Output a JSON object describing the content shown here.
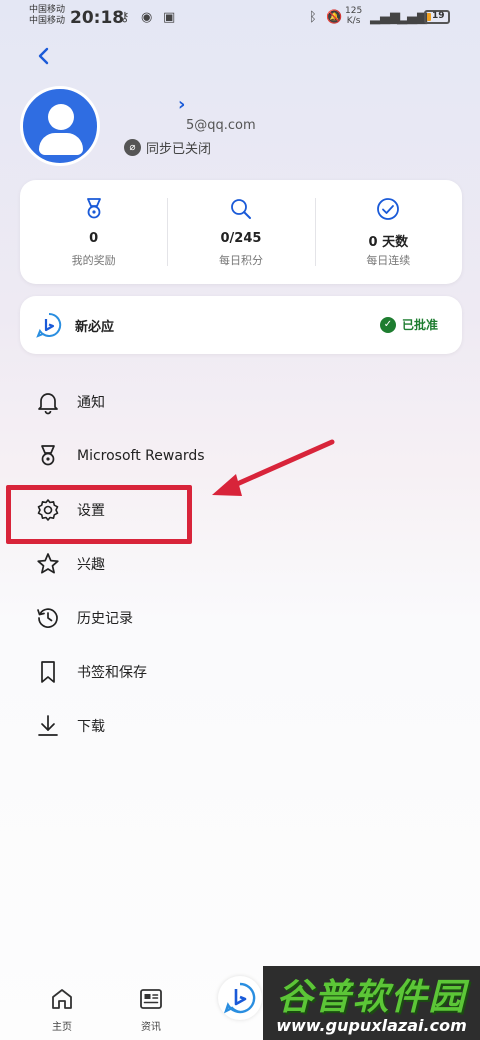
{
  "status_bar": {
    "carrier_1": "中国移动",
    "carrier_2": "中国移动",
    "time": "20:18",
    "network_speed_value": "125",
    "network_speed_unit": "K/s",
    "battery": "19",
    "battery_level": 0.19
  },
  "profile": {
    "arrow": "›",
    "email": "5@qq.com",
    "sync_label": "同步已关闭"
  },
  "stats": [
    {
      "value": "0",
      "label": "我的奖励",
      "icon": "medal-icon"
    },
    {
      "value": "0/245",
      "label": "每日积分",
      "icon": "search-icon"
    },
    {
      "value": "0 天数",
      "label": "每日连续",
      "icon": "check-circle-icon"
    }
  ],
  "bing_card": {
    "title": "新必应",
    "status": "已批准"
  },
  "menu": [
    {
      "label": "通知",
      "icon": "bell-icon"
    },
    {
      "label": "Microsoft Rewards",
      "icon": "medal-icon"
    },
    {
      "label": "设置",
      "icon": "gear-icon"
    },
    {
      "label": "兴趣",
      "icon": "star-icon"
    },
    {
      "label": "历史记录",
      "icon": "history-icon"
    },
    {
      "label": "书签和保存",
      "icon": "bookmark-icon"
    },
    {
      "label": "下载",
      "icon": "download-icon"
    }
  ],
  "bottom_nav": {
    "home": "主页",
    "news": "资讯"
  },
  "watermark": {
    "title": "谷普软件园",
    "url": "www.gupuxlazai.com"
  },
  "colors": {
    "accent_blue": "#1a5ad8",
    "avatar_blue": "#2f6de2",
    "approved_green": "#1e7d30",
    "annotation_red": "#d8243a"
  }
}
